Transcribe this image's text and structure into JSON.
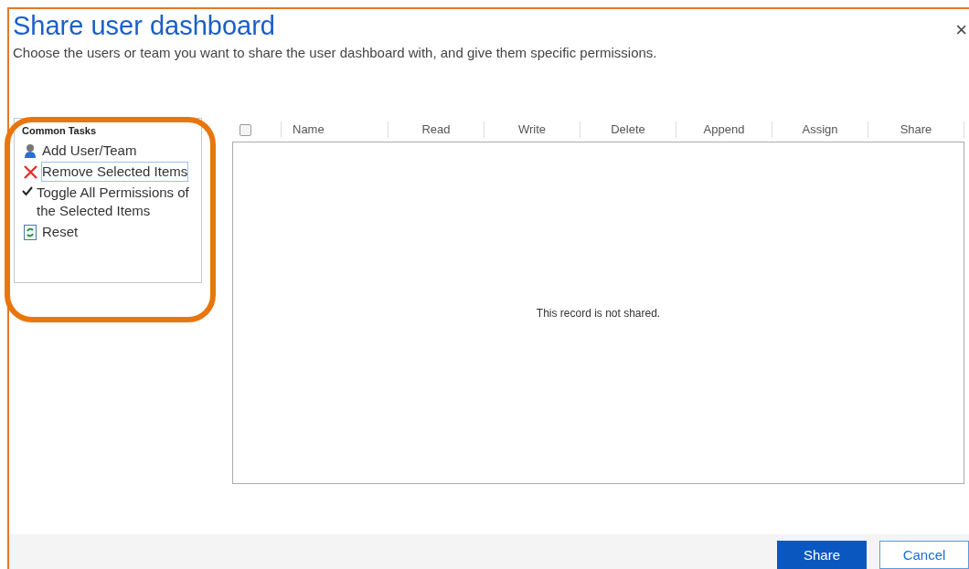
{
  "dialog": {
    "title": "Share user dashboard",
    "subtitle": "Choose the users or team you want to share the user dashboard with, and give them specific permissions.",
    "close": "×"
  },
  "tasks": {
    "heading": "Common Tasks",
    "items": [
      {
        "kind": "user",
        "label": "Add User/Team",
        "focused": false
      },
      {
        "kind": "remove",
        "label": "Remove Selected Items",
        "focused": true
      },
      {
        "kind": "toggle",
        "label": "Toggle All Permissions of the Selected Items",
        "focused": false
      },
      {
        "kind": "reset",
        "label": "Reset",
        "focused": false
      }
    ]
  },
  "table": {
    "select_all": {
      "checked": false
    },
    "columns": [
      "Name",
      "Read",
      "Write",
      "Delete",
      "Append",
      "Assign",
      "Share"
    ],
    "empty_message": "This record is not shared."
  },
  "buttons": [
    {
      "kind": "primary",
      "label": "Share"
    },
    {
      "kind": "secondary",
      "label": "Cancel"
    }
  ]
}
